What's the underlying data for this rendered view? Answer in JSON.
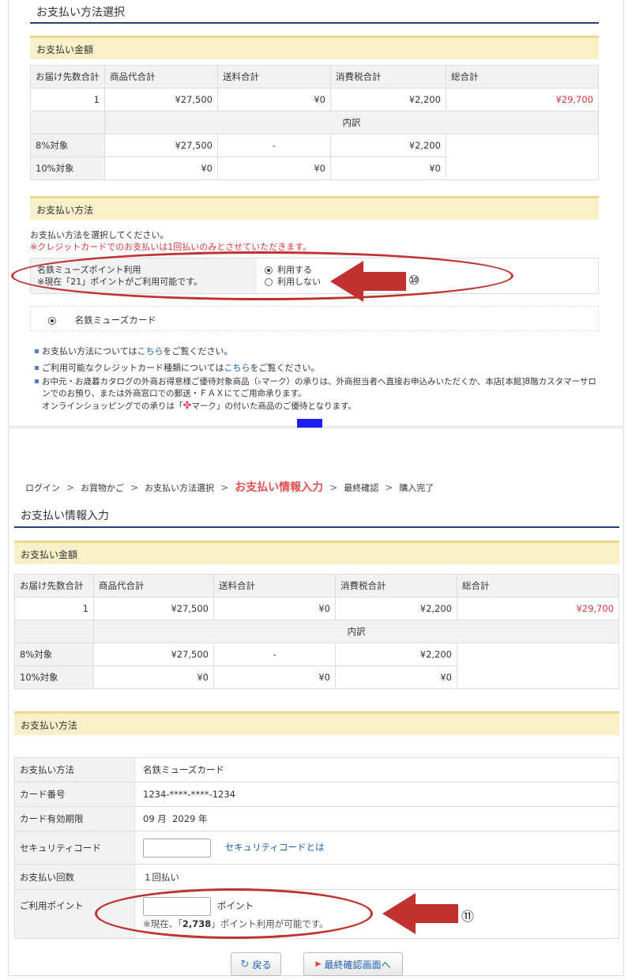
{
  "top": {
    "page_title": "お支払い方法選択",
    "amount_section": "お支払い金額",
    "headers": [
      "お届け先数合計",
      "商品代合計",
      "送料合計",
      "消費税合計",
      "総合計"
    ],
    "row": [
      "1",
      "¥27,500",
      "¥0",
      "¥2,200",
      "¥29,700"
    ],
    "breakdown_label": "内訳",
    "tax_rows": [
      {
        "label": "8%対象",
        "goods": "¥27,500",
        "shipping": "-",
        "tax": "¥2,200"
      },
      {
        "label": "10%対象",
        "goods": "¥0",
        "shipping": "¥0",
        "tax": "¥0"
      }
    ],
    "method_section": "お支払い方法",
    "instruction": "お支払い方法を選択してください。",
    "credit_note": "※クレジットカードでのお支払いは1回払いのみとさせていただきます。",
    "points": {
      "label": "名鉄ミューズポイント利用",
      "available": "※現在「21」ポイントがご利用可能です。",
      "use": "利用する",
      "no_use": "利用しない"
    },
    "card_option": "名鉄ミューズカード",
    "callout_number": "⑩",
    "notes": {
      "n1_pre": "お支払い方法については",
      "n1_link": "こちら",
      "n1_post": "をご覧ください。",
      "n2_pre": "ご利用可能なクレジットカード種類については",
      "n2_link": "こちら",
      "n2_post": "をご覧ください。",
      "n3_line1": "お中元・お歳暮カタログの外商お得意様ご優待対象商品（♭マーク）の承りは、外商担当者へ直接お申込みいただくか、本店[本館]8階カスタマーサロ",
      "n3_line2": "ンでのお預り、または外商窓口での郵送・ＦＡＸにてご用命承ります。",
      "n3_line3_pre": "オンラインショッピングでの承りは「",
      "n3_line3_post": "マーク」の付いた商品のご優待となります。"
    }
  },
  "breadcrumb": [
    "ログイン",
    "お買物かご",
    "お支払い方法選択",
    "お支払い情報入力",
    "最終確認",
    "購入完了"
  ],
  "bottom": {
    "page_title": "お支払い情報入力",
    "amount_section": "お支払い金額",
    "method_section": "お支払い方法",
    "details": {
      "method_label": "お支払い方法",
      "method_value": "名鉄ミューズカード",
      "card_label": "カード番号",
      "card_value": "1234-****-****-1234",
      "expiry_label": "カード有効期限",
      "expiry_value": "09 月  2029 年",
      "security_label": "セキュリティコード",
      "security_link": "セキュリティコードとは",
      "installments_label": "お支払い回数",
      "installments_value": "１回払い",
      "points_label": "ご利用ポイント",
      "points_unit": "ポイント",
      "points_note_pre": "※現在、「",
      "points_note_value": "2,738",
      "points_note_post": "」ポイント利用が可能です。"
    },
    "callout_number": "⑪",
    "back_button": "戻る",
    "next_button": "最終確認画面へ"
  },
  "colors": {
    "accent_red": "#d9363e",
    "arrow_red": "#c0322f",
    "arrow_blue": "#1c1cf0",
    "section_bg": "#f7f0c8",
    "title_line": "#2c3e78"
  }
}
